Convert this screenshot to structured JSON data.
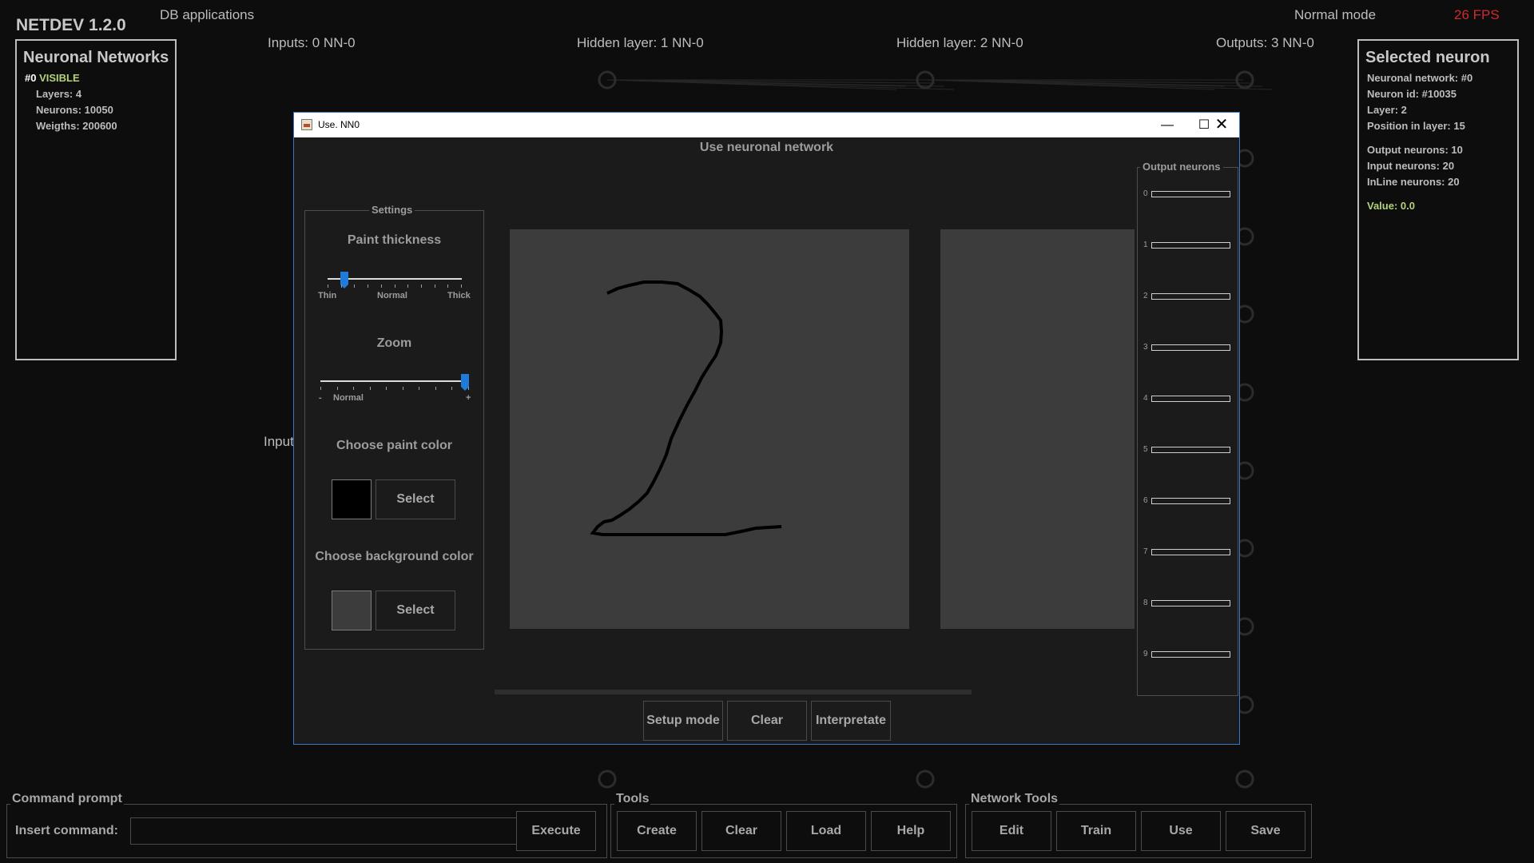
{
  "app": {
    "title": "NETDEV 1.2.0",
    "menu": "DB applications",
    "mode": "Normal mode",
    "fps": "26 FPS"
  },
  "layers": [
    {
      "label": "Inputs: 0  NN-0"
    },
    {
      "label": "Hidden layer: 1  NN-0"
    },
    {
      "label": "Hidden layer: 2  NN-0"
    },
    {
      "label": "Outputs: 3  NN-0"
    }
  ],
  "side_label": "Input",
  "networks_panel": {
    "title": "Neuronal Networks",
    "item_id": "#0",
    "item_status": "VISIBLE",
    "layers": "Layers: 4",
    "neurons": "Neurons: 10050",
    "weights": "Weigths: 200600"
  },
  "neuron_panel": {
    "title": "Selected neuron",
    "network": "Neuronal network: #0",
    "neuron_id": "Neuron id: #10035",
    "layer": "Layer: 2",
    "position": "Position in layer: 15",
    "output_neurons": "Output neurons: 10",
    "input_neurons": "Input neurons: 20",
    "inline_neurons": "InLine neurons: 20",
    "value": "Value: 0.0"
  },
  "dialog": {
    "window_title": "Use. NN0",
    "heading": "Use neuronal network",
    "settings": {
      "legend": "Settings",
      "paint_thickness": "Paint thickness",
      "thickness_ticks": {
        "left": "Thin",
        "mid": "Normal",
        "right": "Thick"
      },
      "thickness_value": 0.1,
      "zoom": "Zoom",
      "zoom_ticks": {
        "left": "-",
        "mid": "Normal",
        "right": "+"
      },
      "zoom_value": 1.0,
      "paint_color_label": "Choose paint color",
      "paint_color": "#000000",
      "bg_color_label": "Choose background color",
      "bg_color": "#3c3c3c",
      "select_label": "Select"
    },
    "output_legend": "Output neurons",
    "outputs": [
      "0",
      "1",
      "2",
      "3",
      "4",
      "5",
      "6",
      "7",
      "8",
      "9"
    ],
    "buttons": {
      "setup": "Setup mode",
      "clear": "Clear",
      "interpret": "Interpretate"
    }
  },
  "command": {
    "legend": "Command prompt",
    "label": "Insert command:",
    "value": "",
    "execute": "Execute"
  },
  "tools": {
    "legend": "Tools",
    "buttons": [
      "Create",
      "Clear",
      "Load",
      "Help"
    ]
  },
  "network_tools": {
    "legend": "Network Tools",
    "buttons": [
      "Edit",
      "Train",
      "Use",
      "Save"
    ]
  }
}
